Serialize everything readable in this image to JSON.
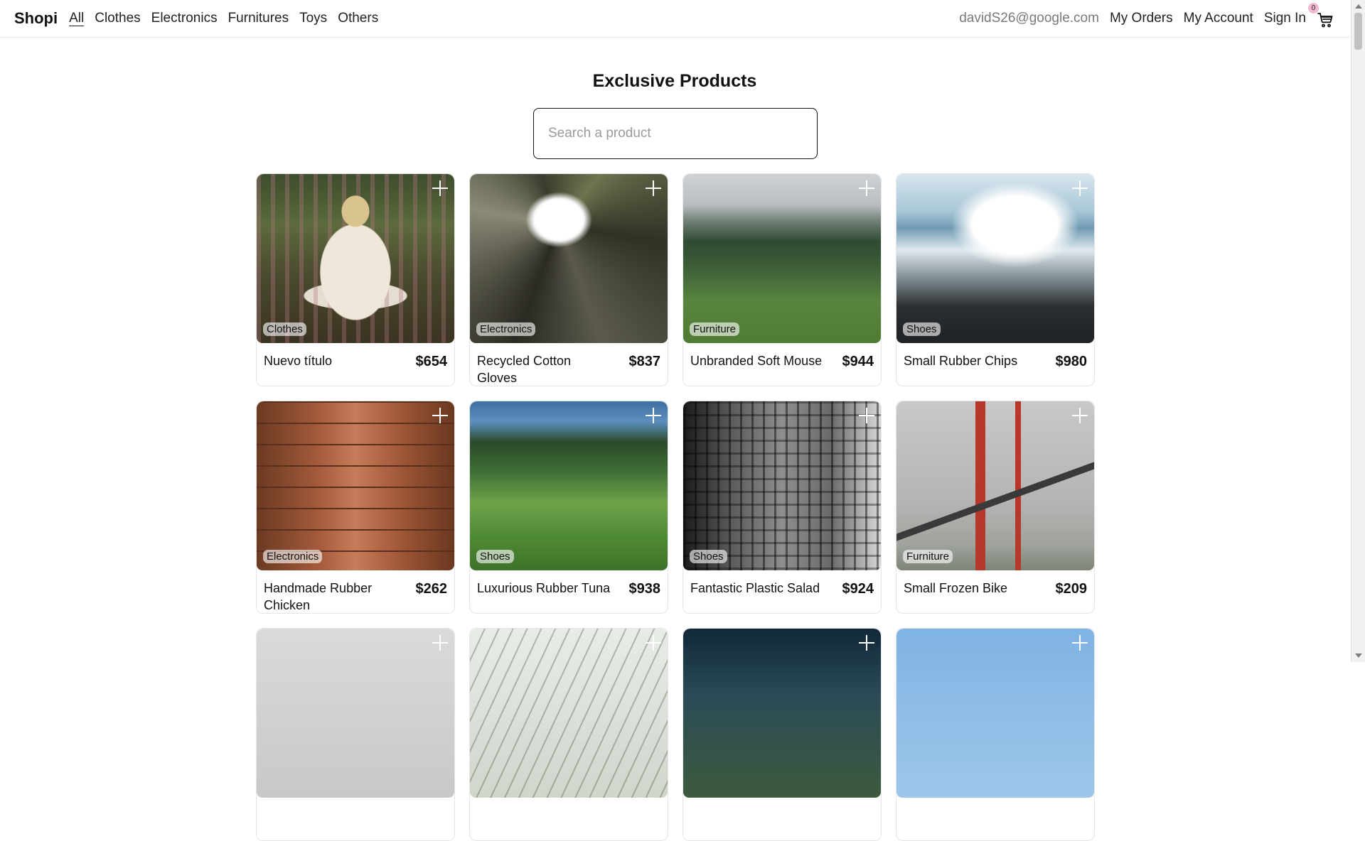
{
  "navbar": {
    "brand": "Shopi",
    "categories": [
      "All",
      "Clothes",
      "Electronics",
      "Furnitures",
      "Toys",
      "Others"
    ],
    "active_category": "All",
    "user_email": "davidS26@google.com",
    "my_orders": "My Orders",
    "my_account": "My Account",
    "sign_in": "Sign In",
    "cart_count": "0",
    "cart_icon": "shopping-cart-icon"
  },
  "main": {
    "title": "Exclusive Products",
    "search": {
      "placeholder": "Search a product",
      "value": ""
    }
  },
  "products": [
    {
      "title": "Nuevo título",
      "price": "$654",
      "category": "Clothes",
      "image": "pug-in-blanket"
    },
    {
      "title": "Recycled Cotton Gloves",
      "price": "$837",
      "category": "Electronics",
      "image": "building-looking-up"
    },
    {
      "title": "Unbranded Soft Mouse",
      "price": "$944",
      "category": "Furniture",
      "image": "misty-hills"
    },
    {
      "title": "Small Rubber Chips",
      "price": "$980",
      "category": "Shoes",
      "image": "waves-on-rocks"
    },
    {
      "title": "Handmade Rubber Chicken",
      "price": "$262",
      "category": "Electronics",
      "image": "wood-planks"
    },
    {
      "title": "Luxurious Rubber Tuna",
      "price": "$938",
      "category": "Shoes",
      "image": "grass-field"
    },
    {
      "title": "Fantastic Plastic Salad",
      "price": "$924",
      "category": "Shoes",
      "image": "tall-building-bw"
    },
    {
      "title": "Small Frozen Bike",
      "price": "$209",
      "category": "Furniture",
      "image": "golden-gate-bridge"
    },
    {
      "title": "",
      "price": "",
      "category": "",
      "image": "foggy-field"
    },
    {
      "title": "",
      "price": "",
      "category": "",
      "image": "branches"
    },
    {
      "title": "",
      "price": "",
      "category": "",
      "image": "dark-landscape"
    },
    {
      "title": "",
      "price": "",
      "category": "",
      "image": "blue-sky"
    }
  ],
  "colors": {
    "cart_badge": "#f2b8cf",
    "border": "#e6e6e6",
    "text": "#111111",
    "muted_text": "#7a7a7a"
  }
}
